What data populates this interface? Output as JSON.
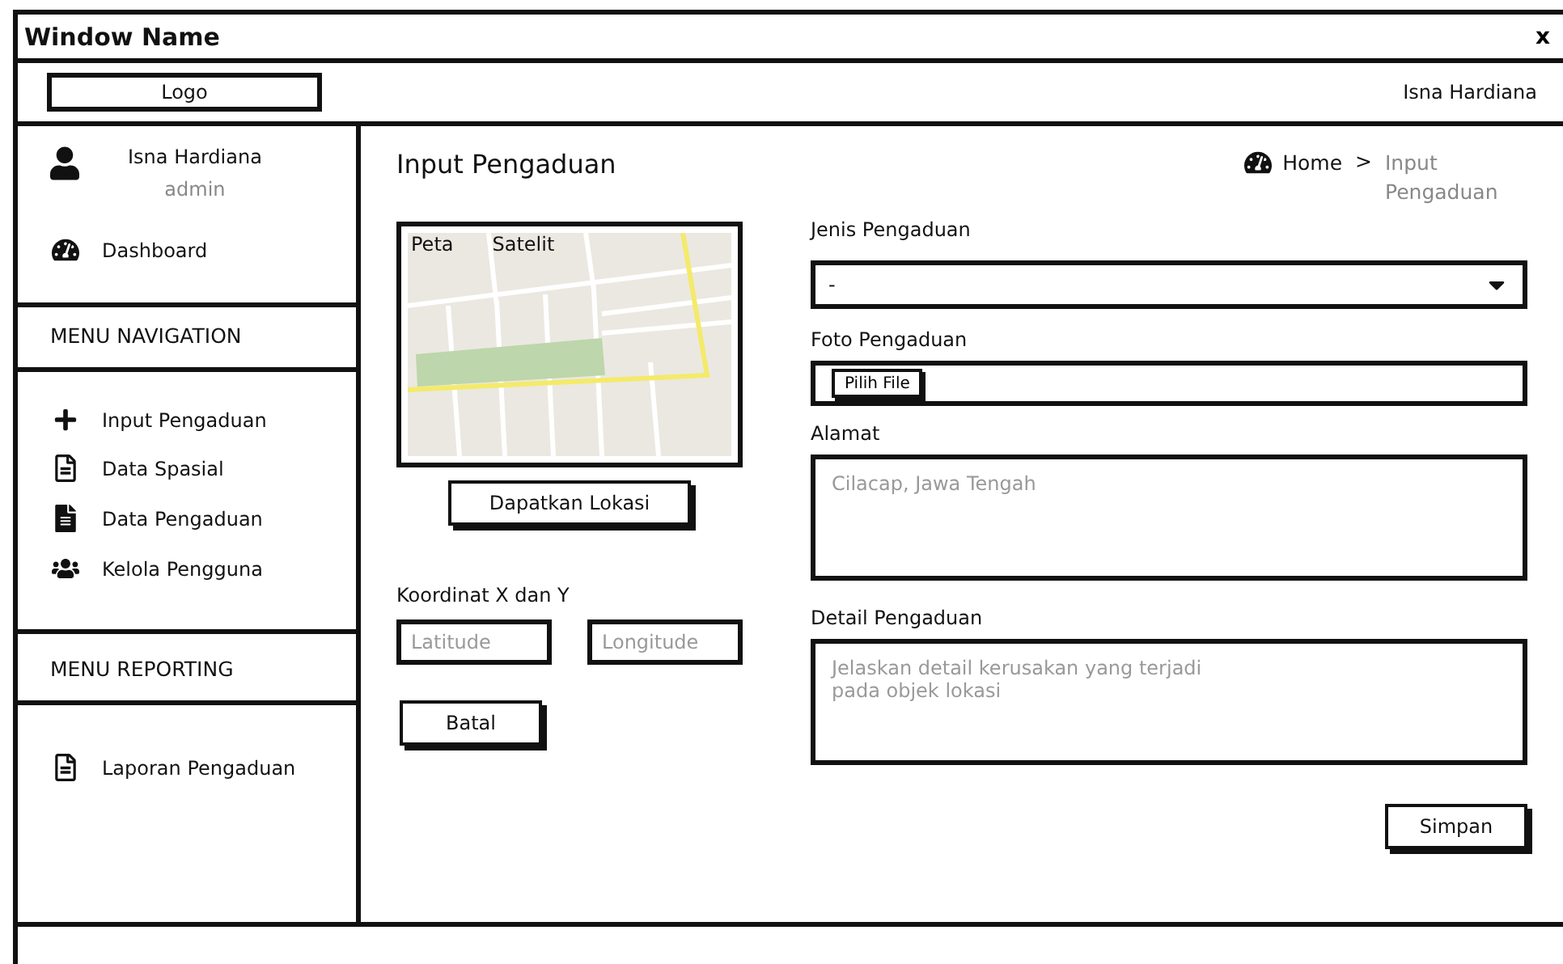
{
  "window": {
    "title": "Window Name",
    "close": "x"
  },
  "header": {
    "logo": "Logo",
    "user": "Isna Hardiana"
  },
  "sidebar": {
    "user": {
      "name": "Isna Hardiana",
      "role": "admin"
    },
    "dashboard": "Dashboard",
    "navigation": {
      "title": "MENU NAVIGATION",
      "items": [
        "Input Pengaduan",
        "Data Spasial",
        "Data Pengaduan",
        "Kelola Pengguna"
      ]
    },
    "reporting": {
      "title": "MENU REPORTING",
      "items": [
        "Laporan Pengaduan"
      ]
    }
  },
  "page": {
    "title": "Input Pengaduan",
    "breadcrumb": {
      "home": "Home",
      "separator": ">",
      "current": "Input Pengaduan"
    }
  },
  "map": {
    "tabs": [
      "Peta",
      "Satelit"
    ],
    "button": "Dapatkan Lokasi"
  },
  "coordinates": {
    "label": "Koordinat X dan Y",
    "latitude": {
      "placeholder": "Latitude"
    },
    "longitude": {
      "placeholder": "Longitude"
    }
  },
  "cancel_button": "Batal",
  "form": {
    "type": {
      "label": "Jenis Pengaduan",
      "value": "-"
    },
    "photo": {
      "label": "Foto Pengaduan",
      "button": "Pilih File"
    },
    "address": {
      "label": "Alamat",
      "placeholder": "Cilacap, Jawa Tengah"
    },
    "detail": {
      "label": "Detail Pengaduan",
      "placeholder": "Jelaskan detail kerusakan yang terjadi\npada objek lokasi"
    },
    "save_button": "Simpan"
  }
}
